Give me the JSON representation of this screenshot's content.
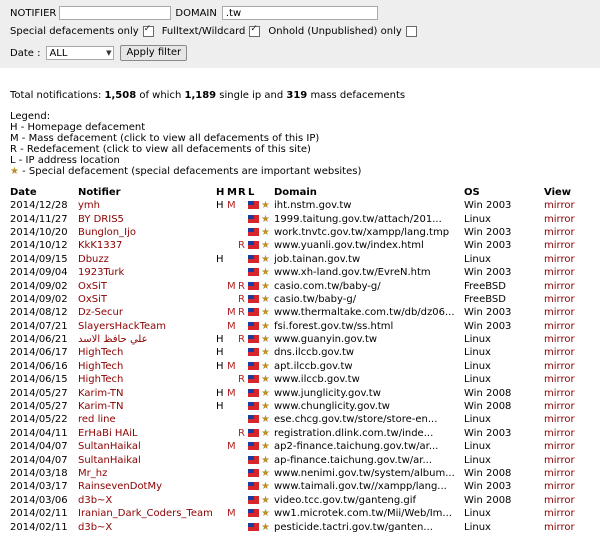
{
  "filters": {
    "notifier_label": "NOTIFIER",
    "notifier_value": "",
    "domain_label": "DOMAIN",
    "domain_value": ".tw",
    "special_label": "Special defacements only",
    "special_checked": true,
    "fulltext_label": "Fulltext/Wildcard",
    "fulltext_checked": true,
    "onhold_label": "Onhold (Unpublished) only",
    "onhold_checked": false,
    "date_label": "Date :",
    "date_value": "ALL",
    "apply_label": "Apply filter"
  },
  "summary": {
    "prefix": "Total notifications: ",
    "total": "1,508",
    "mid1": " of which ",
    "single": "1,189",
    "mid2": " single ip and ",
    "mass": "319",
    "suffix": " mass defacements"
  },
  "legend": {
    "title": "Legend:",
    "h": "H - Homepage defacement",
    "m": "M - Mass defacement (click to view all defacements of this IP)",
    "r": "R - Redefacement (click to view all defacements of this site)",
    "l": "L - IP address location",
    "star_text": " - Special defacement (special defacements are important websites)"
  },
  "table": {
    "headers": {
      "date": "Date",
      "notifier": "Notifier",
      "h": "H",
      "m": "M",
      "r": "R",
      "l": "L",
      "domain": "Domain",
      "os": "OS",
      "view": "View"
    },
    "star_glyph": "★",
    "rows": [
      {
        "date": "2014/12/28",
        "notifier": "ymh",
        "h": "H",
        "m": "M",
        "r": "",
        "domain": "iht.nstm.gov.tw",
        "os": "Win 2003",
        "view": "mirror"
      },
      {
        "date": "2014/11/27",
        "notifier": "BY DRIS5",
        "h": "",
        "m": "",
        "r": "",
        "domain": "1999.taitung.gov.tw/attach/201...",
        "os": "Linux",
        "view": "mirror"
      },
      {
        "date": "2014/10/20",
        "notifier": "Bunglon_Ijo",
        "h": "",
        "m": "",
        "r": "",
        "domain": "work.tnvtc.gov.tw/xampp/lang.tmp",
        "os": "Win 2003",
        "view": "mirror"
      },
      {
        "date": "2014/10/12",
        "notifier": "KkK1337",
        "h": "",
        "m": "",
        "r": "R",
        "domain": "www.yuanli.gov.tw/index.html",
        "os": "Win 2003",
        "view": "mirror"
      },
      {
        "date": "2014/09/15",
        "notifier": "Dbuzz",
        "h": "H",
        "m": "",
        "r": "",
        "domain": "job.tainan.gov.tw",
        "os": "Linux",
        "view": "mirror"
      },
      {
        "date": "2014/09/04",
        "notifier": "1923Turk",
        "h": "",
        "m": "",
        "r": "",
        "domain": "www.xh-land.gov.tw/EvreN.htm",
        "os": "Win 2003",
        "view": "mirror"
      },
      {
        "date": "2014/09/02",
        "notifier": "OxSiT",
        "h": "",
        "m": "M",
        "r": "R",
        "domain": "casio.com.tw/baby-g/",
        "os": "FreeBSD",
        "view": "mirror"
      },
      {
        "date": "2014/09/02",
        "notifier": "OxSiT",
        "h": "",
        "m": "",
        "r": "R",
        "domain": "casio.tw/baby-g/",
        "os": "FreeBSD",
        "view": "mirror"
      },
      {
        "date": "2014/08/12",
        "notifier": "Dz-Secur",
        "h": "",
        "m": "M",
        "r": "R",
        "domain": "www.thermaltake.com.tw/db/dz06...",
        "os": "Win 2003",
        "view": "mirror"
      },
      {
        "date": "2014/07/21",
        "notifier": "SlayersHackTeam",
        "h": "",
        "m": "M",
        "r": "",
        "domain": "fsi.forest.gov.tw/ss.html",
        "os": "Win 2003",
        "view": "mirror"
      },
      {
        "date": "2014/06/21",
        "notifier": "علي حافظ الاسد",
        "h": "H",
        "m": "",
        "r": "R",
        "domain": "www.guanyin.gov.tw",
        "os": "Linux",
        "view": "mirror"
      },
      {
        "date": "2014/06/17",
        "notifier": "HighTech",
        "h": "H",
        "m": "",
        "r": "",
        "domain": "dns.ilccb.gov.tw",
        "os": "Linux",
        "view": "mirror"
      },
      {
        "date": "2014/06/16",
        "notifier": "HighTech",
        "h": "H",
        "m": "M",
        "r": "",
        "domain": "apt.ilccb.gov.tw",
        "os": "Linux",
        "view": "mirror"
      },
      {
        "date": "2014/06/15",
        "notifier": "HighTech",
        "h": "",
        "m": "",
        "r": "R",
        "domain": "www.ilccb.gov.tw",
        "os": "Linux",
        "view": "mirror"
      },
      {
        "date": "2014/05/27",
        "notifier": "Karim-TN",
        "h": "H",
        "m": "M",
        "r": "",
        "domain": "www.junglicity.gov.tw",
        "os": "Win 2008",
        "view": "mirror"
      },
      {
        "date": "2014/05/27",
        "notifier": "Karim-TN",
        "h": "H",
        "m": "",
        "r": "",
        "domain": "www.chunglicity.gov.tw",
        "os": "Win 2008",
        "view": "mirror"
      },
      {
        "date": "2014/05/22",
        "notifier": "red line",
        "h": "",
        "m": "",
        "r": "",
        "domain": "ese.chcg.gov.tw/store/store-en...",
        "os": "Linux",
        "view": "mirror"
      },
      {
        "date": "2014/04/11",
        "notifier": "ErHaBi HAiL",
        "h": "",
        "m": "",
        "r": "R",
        "domain": "registration.dlink.com.tw/inde...",
        "os": "Win 2003",
        "view": "mirror"
      },
      {
        "date": "2014/04/07",
        "notifier": "SultanHaikal",
        "h": "",
        "m": "M",
        "r": "",
        "domain": "ap2-finance.taichung.gov.tw/ar...",
        "os": "Linux",
        "view": "mirror"
      },
      {
        "date": "2014/04/07",
        "notifier": "SultanHaikal",
        "h": "",
        "m": "",
        "r": "",
        "domain": "ap-finance.taichung.gov.tw/ar...",
        "os": "Linux",
        "view": "mirror"
      },
      {
        "date": "2014/03/18",
        "notifier": "Mr_hz",
        "h": "",
        "m": "",
        "r": "",
        "domain": "www.nenimi.gov.tw/system/album...",
        "os": "Win 2008",
        "view": "mirror"
      },
      {
        "date": "2014/03/17",
        "notifier": "RainsevenDotMy",
        "h": "",
        "m": "",
        "r": "",
        "domain": "www.taimali.gov.tw//xampp/lang...",
        "os": "Win 2003",
        "view": "mirror"
      },
      {
        "date": "2014/03/06",
        "notifier": "d3b~X",
        "h": "",
        "m": "",
        "r": "",
        "domain": "video.tcc.gov.tw/ganteng.gif",
        "os": "Win 2008",
        "view": "mirror"
      },
      {
        "date": "2014/02/11",
        "notifier": "Iranian_Dark_Coders_Team",
        "h": "",
        "m": "M",
        "r": "",
        "domain": "ww1.microtek.com.tw/Mii/Web/Im...",
        "os": "Linux",
        "view": "mirror"
      },
      {
        "date": "2014/02/11",
        "notifier": "d3b~X",
        "h": "",
        "m": "",
        "r": "",
        "domain": "pesticide.tactri.gov.tw/ganten...",
        "os": "Linux",
        "view": "mirror"
      }
    ]
  }
}
